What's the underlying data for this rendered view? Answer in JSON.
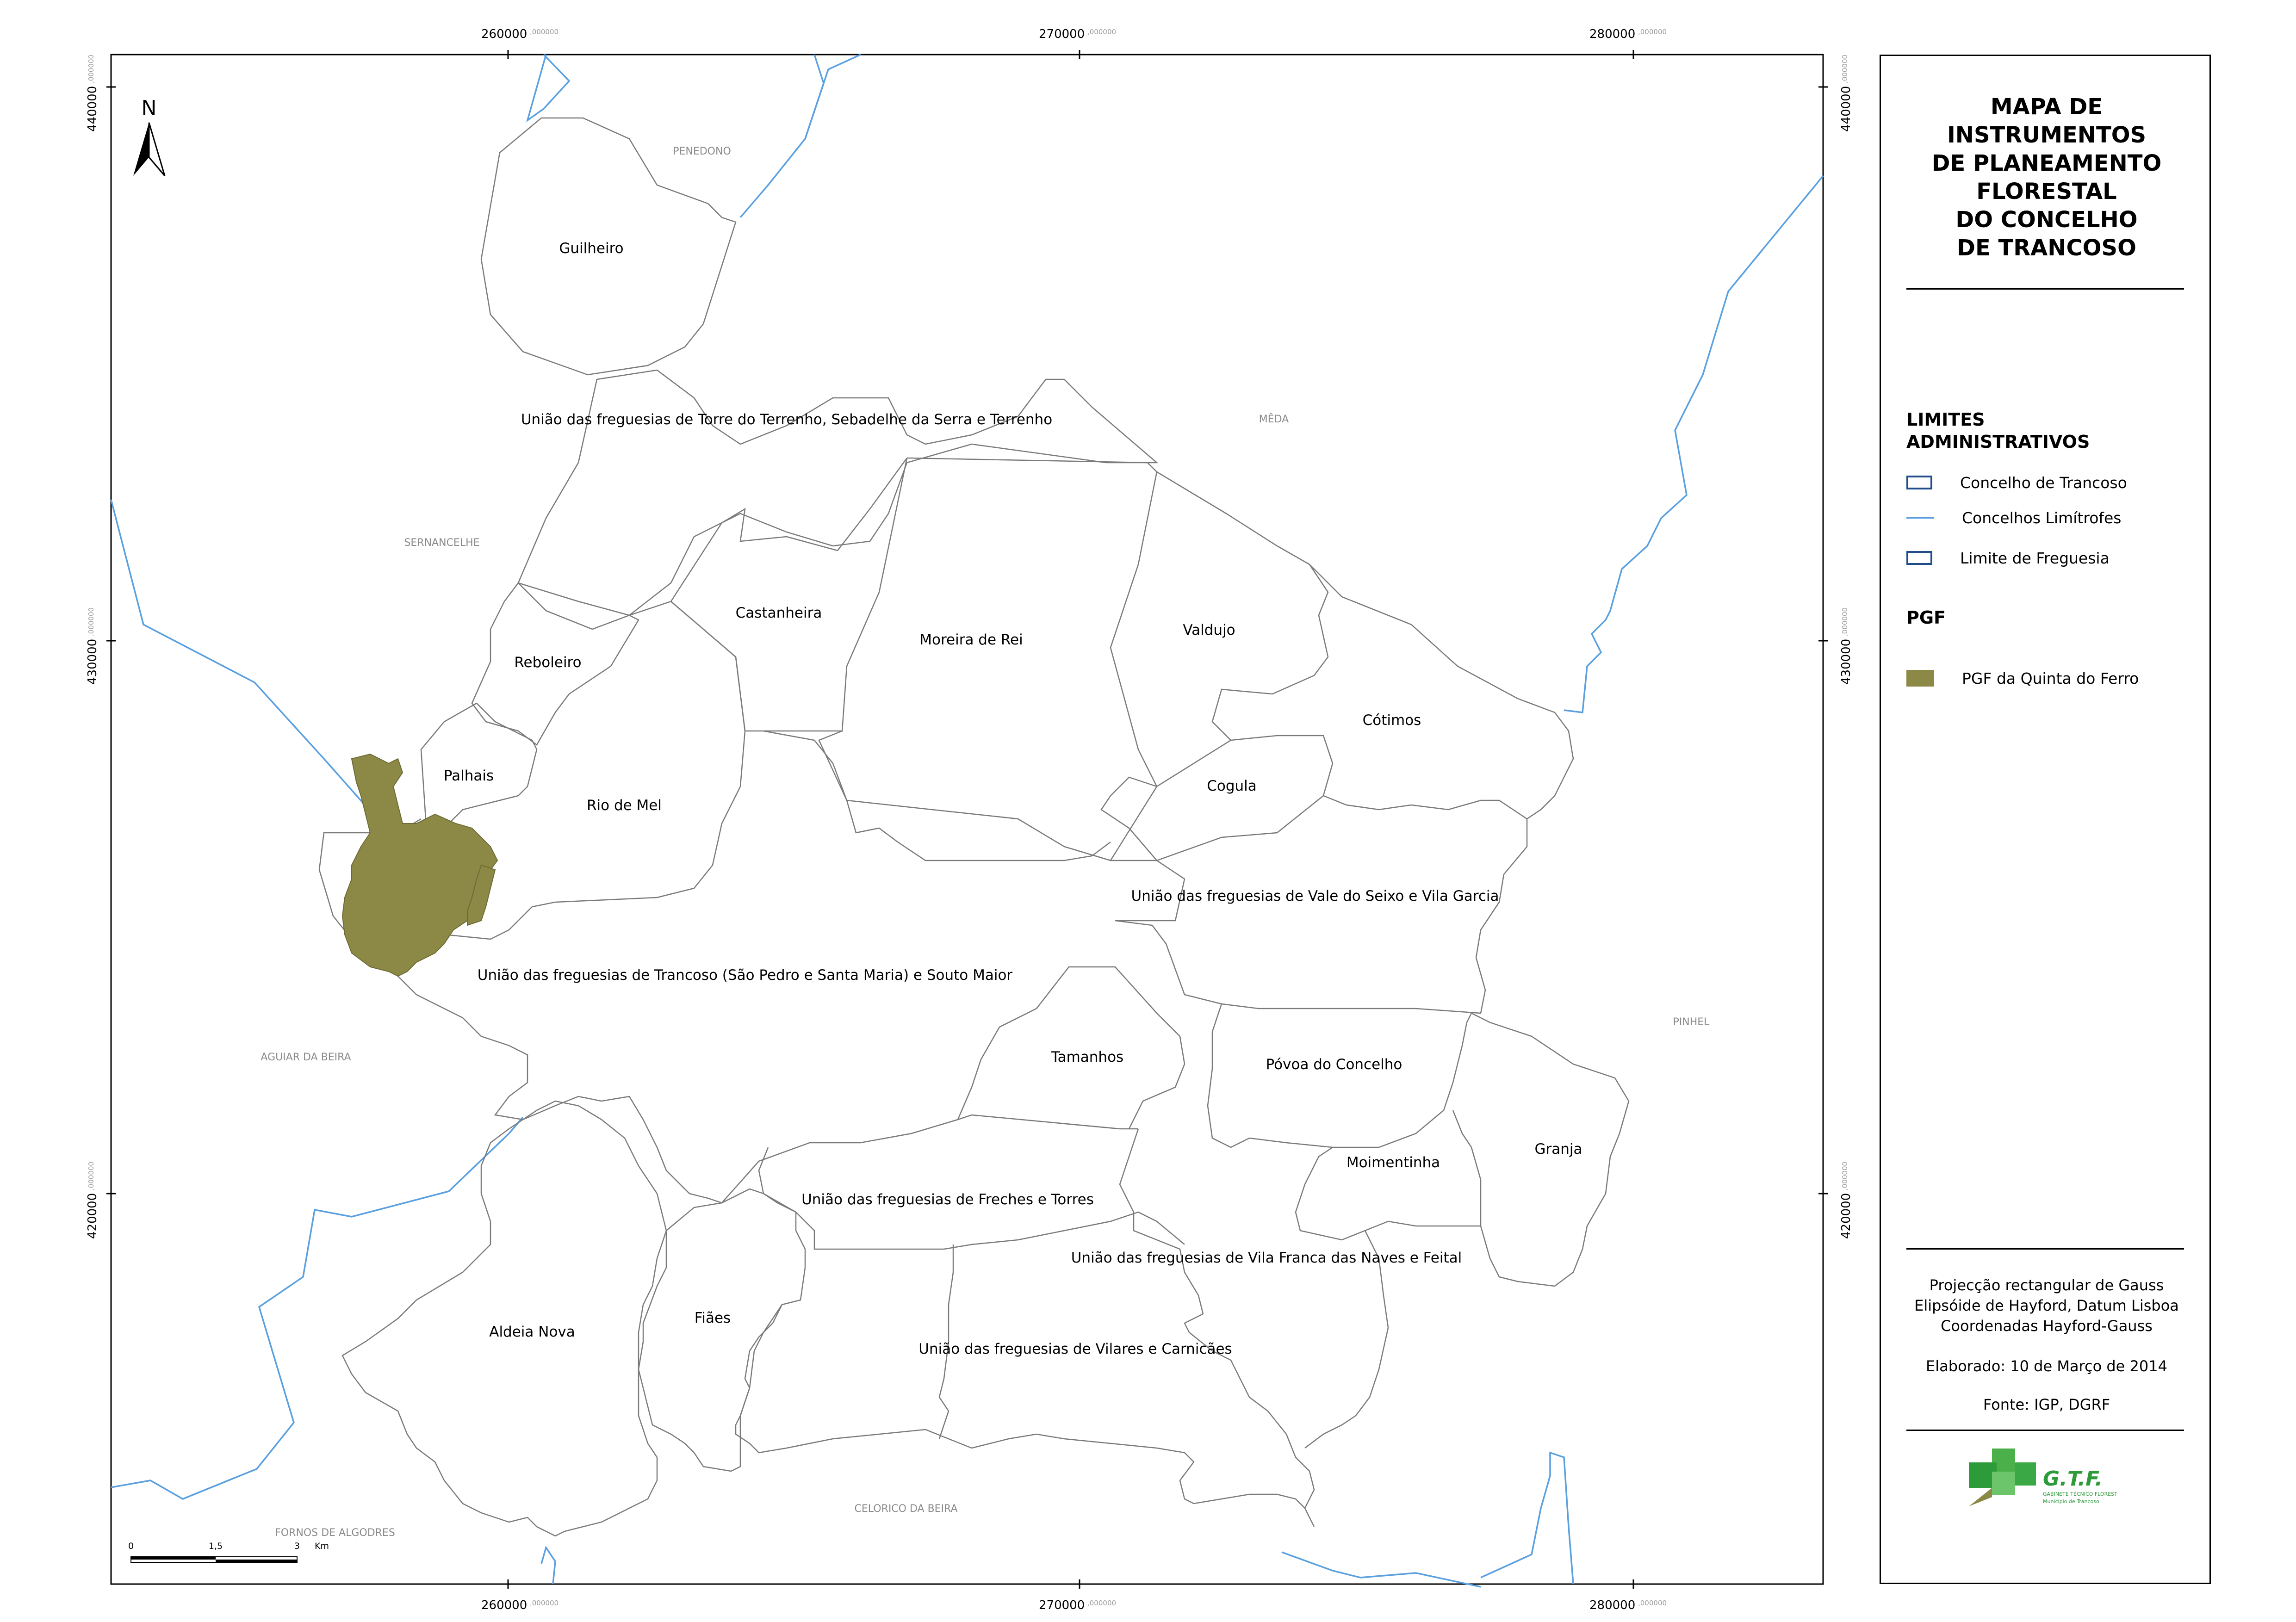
{
  "map": {
    "coords": {
      "x_top": [
        {
          "v": "260000",
          "d": ",000000"
        },
        {
          "v": "270000",
          "d": ",000000"
        },
        {
          "v": "280000",
          "d": ",000000"
        }
      ],
      "x_bottom": [
        {
          "v": "260000",
          "d": ",000000"
        },
        {
          "v": "270000",
          "d": ",000000"
        },
        {
          "v": "280000",
          "d": ",000000"
        }
      ],
      "y_left": [
        {
          "v": "440000",
          "d": ",000000"
        },
        {
          "v": "430000",
          "d": ",000000"
        },
        {
          "v": "420000",
          "d": ",000000"
        }
      ],
      "y_right": [
        {
          "v": "440000",
          "d": ",000000"
        },
        {
          "v": "430000",
          "d": ",000000"
        },
        {
          "v": "420000",
          "d": ",000000"
        }
      ]
    },
    "north": "N",
    "scalebar": {
      "t0": "0",
      "t1": "1,5",
      "t2": "3",
      "unit": "Km"
    },
    "freguesias": [
      "Guilheiro",
      "União das freguesias de Torre do Terrenho, Sebadelhe da Serra e Terrenho",
      "Castanheira",
      "Moreira de Rei",
      "Valdujo",
      "Reboleiro",
      "Cótimos",
      "Palhais",
      "Cogula",
      "Rio de Mel",
      "União das freguesias de Vale do Seixo e Vila Garcia",
      "União das freguesias de Trancoso (São Pedro e Santa Maria) e Souto Maior",
      "Tamanhos",
      "Póvoa do Concelho",
      "Granja",
      "Moimentinha",
      "União das freguesias de Freches e Torres",
      "União das freguesias de Vila Franca das Naves e Feital",
      "Aldeia Nova",
      "Fiães",
      "União das freguesias de Vilares e Carnicães"
    ],
    "concelhos": [
      "PENEDONO",
      "MÊDA",
      "SERNANCELHE",
      "AGUIAR DA BEIRA",
      "PINHEL",
      "FORNOS DE ALGODRES",
      "CELORICO DA BEIRA"
    ]
  },
  "panel": {
    "title": "MAPA DE\nINSTRUMENTOS\nDE PLANEAMENTO\nFLORESTAL\nDO CONCELHO\nDE TRANCOSO",
    "limites_header": "LIMITES\nADMINISTRATIVOS",
    "legend": [
      {
        "label": "Concelho de Trancoso",
        "symbol": "box",
        "color": "#1f4d8a"
      },
      {
        "label": "Concelhos Limítrofes",
        "symbol": "line",
        "color": "#5aa0e0"
      },
      {
        "label": "Limite de Freguesia",
        "symbol": "box",
        "color": "#1f4d8a"
      }
    ],
    "pgf_header": "PGF",
    "pgf_item": {
      "label": "PGF da Quinta do Ferro",
      "color": "#8b8945"
    },
    "projection": [
      "Projecção rectangular de Gauss",
      "Elipsóide de Hayford, Datum Lisboa",
      "Coordenadas Hayford-Gauss"
    ],
    "elaborado": "Elaborado: 10 de Março de 2014",
    "fonte": "Fonte: IGP, DGRF",
    "logo_text": "G.T.F.",
    "logo_sub1": "GABINETE TÉCNICO FLORESTAL",
    "logo_sub2": "Município de Trancoso"
  }
}
